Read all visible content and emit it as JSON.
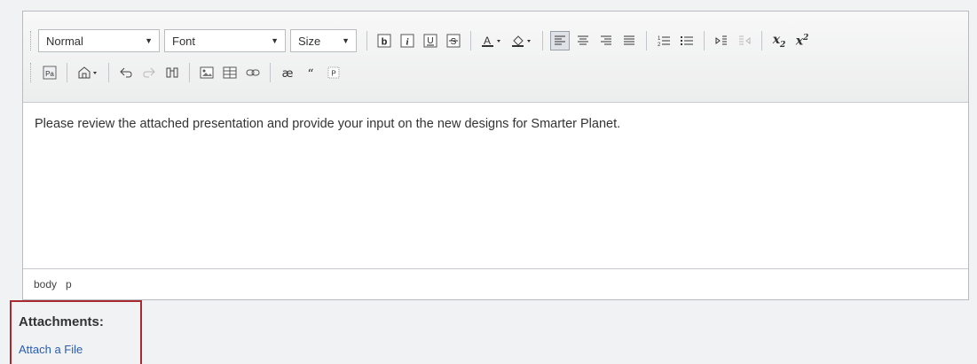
{
  "toolbar": {
    "format_select": "Normal",
    "font_select": "Font",
    "size_select": "Size"
  },
  "editor": {
    "content": "Please review the attached presentation and provide your input on the new designs for Smarter Planet.",
    "path": [
      "body",
      "p"
    ]
  },
  "attachments": {
    "title": "Attachments:",
    "link": "Attach a File"
  },
  "colors": {
    "highlight_border": "#a82a2e",
    "link": "#2a5db0"
  }
}
